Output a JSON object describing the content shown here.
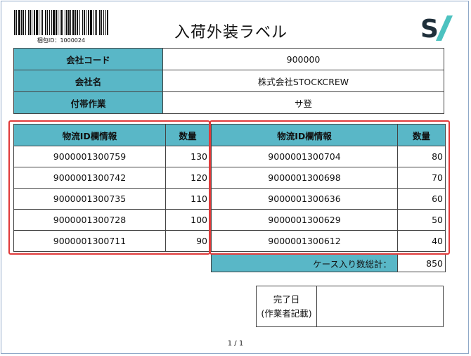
{
  "header": {
    "package_id": "梱包ID：1000024",
    "title": "入荷外装ラベル",
    "logo_icon": "stockcrew-s-slash-logo"
  },
  "company_info": [
    {
      "label": "会社コード",
      "value": "900000"
    },
    {
      "label": "会社名",
      "value": "株式会社STOCKCREW"
    },
    {
      "label": "付帯作業",
      "value": "サ登"
    }
  ],
  "left_list": {
    "headers": {
      "id": "物流ID欄情報",
      "qty": "数量"
    },
    "rows": [
      {
        "id": "9000001300759",
        "qty": "130"
      },
      {
        "id": "9000001300742",
        "qty": "120"
      },
      {
        "id": "9000001300735",
        "qty": "110"
      },
      {
        "id": "9000001300728",
        "qty": "100"
      },
      {
        "id": "9000001300711",
        "qty": "90"
      }
    ]
  },
  "right_list": {
    "headers": {
      "id": "物流ID欄情報",
      "qty": "数量"
    },
    "rows": [
      {
        "id": "9000001300704",
        "qty": "80"
      },
      {
        "id": "9000001300698",
        "qty": "70"
      },
      {
        "id": "9000001300636",
        "qty": "60"
      },
      {
        "id": "9000001300629",
        "qty": "50"
      },
      {
        "id": "9000001300612",
        "qty": "40"
      }
    ]
  },
  "total": {
    "label": "ケース入り数総計：",
    "value": "850"
  },
  "completion": {
    "label_line1": "完了日",
    "label_line2": "(作業者記載)",
    "value": ""
  },
  "footer": {
    "page": "1 / 1"
  },
  "colors": {
    "header_fill": "#59b7c7",
    "highlight_border": "#e03a3a",
    "frame_border": "#8fa8c8"
  }
}
